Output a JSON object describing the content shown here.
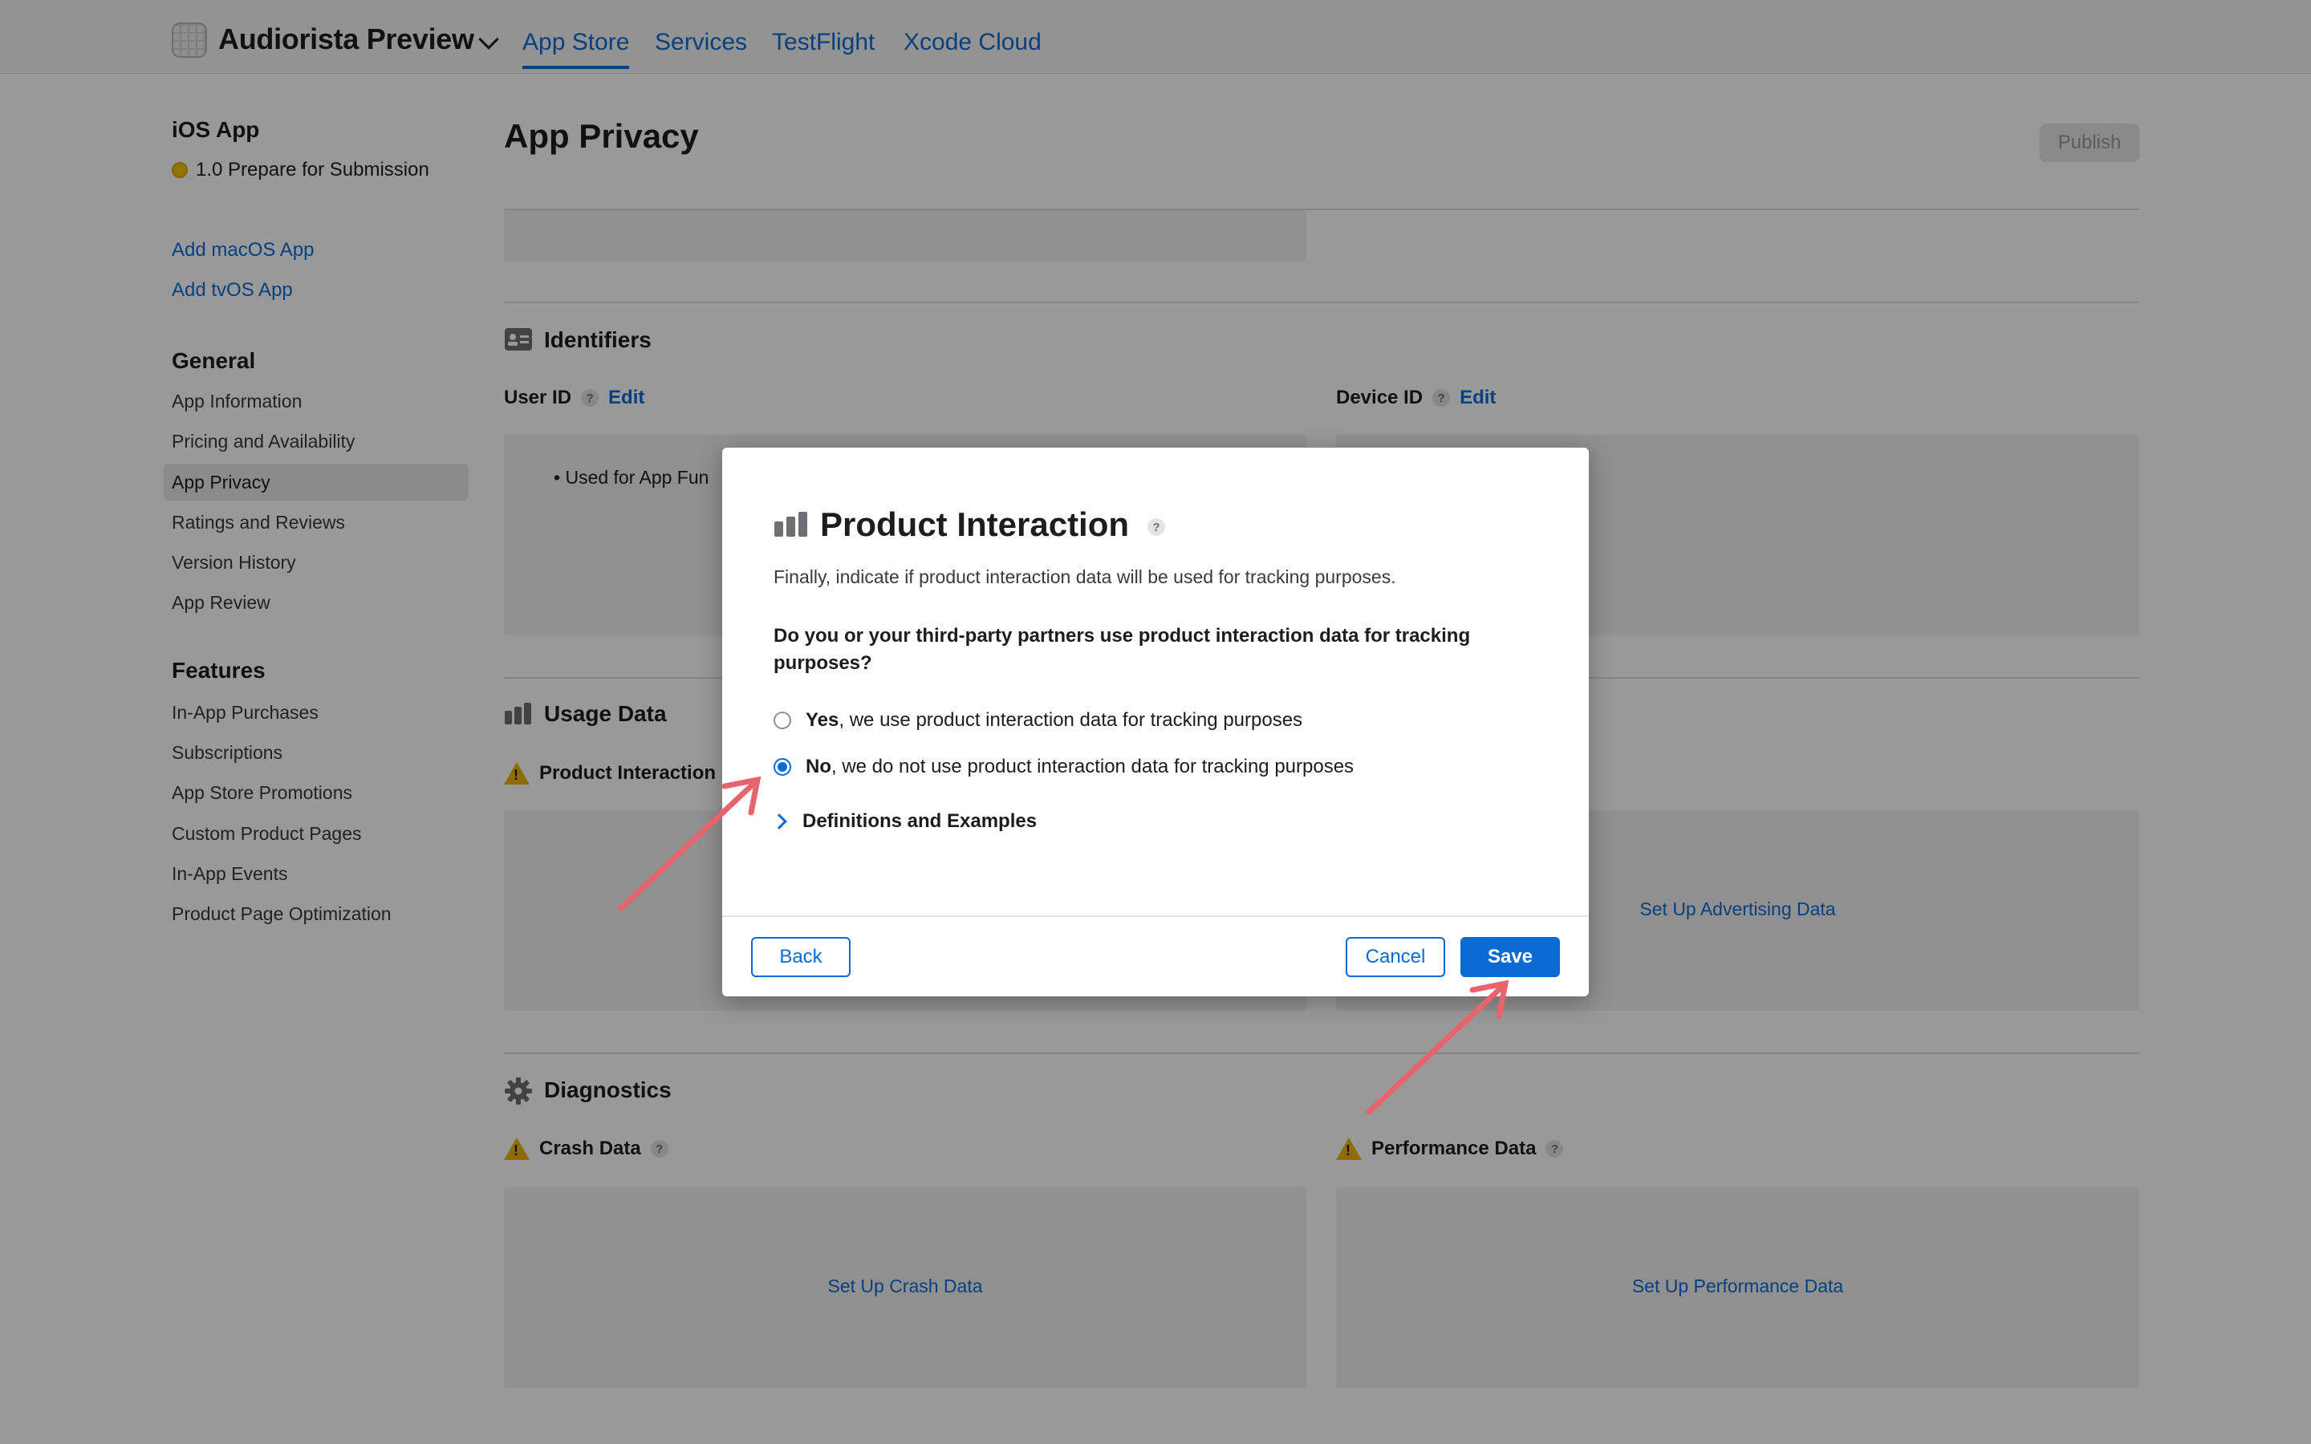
{
  "header": {
    "app_name": "Audiorista Preview",
    "tabs": [
      {
        "label": "App Store",
        "active": true
      },
      {
        "label": "Services"
      },
      {
        "label": "TestFlight"
      },
      {
        "label": "Xcode Cloud"
      }
    ]
  },
  "sidebar": {
    "platform_title": "iOS App",
    "version_status": "1.0 Prepare for Submission",
    "add_links": [
      "Add macOS App",
      "Add tvOS App"
    ],
    "general_title": "General",
    "general_items": [
      "App Information",
      "Pricing and Availability",
      "App Privacy",
      "Ratings and Reviews",
      "Version History",
      "App Review"
    ],
    "features_title": "Features",
    "features_items": [
      "In-App Purchases",
      "Subscriptions",
      "App Store Promotions",
      "Custom Product Pages",
      "In-App Events",
      "Product Page Optimization"
    ],
    "selected": "App Privacy"
  },
  "main": {
    "page_title": "App Privacy",
    "publish_label": "Publish",
    "identifiers": {
      "title": "Identifiers",
      "user_id_label": "User ID",
      "device_id_label": "Device ID",
      "edit_label": "Edit",
      "user_id_usage": "Used for App Fun"
    },
    "usage": {
      "title": "Usage Data",
      "product_interaction_label": "Product Interaction",
      "advertising_link": "Set Up Advertising Data"
    },
    "diagnostics": {
      "title": "Diagnostics",
      "crash_label": "Crash Data",
      "performance_label": "Performance Data",
      "crash_link": "Set Up Crash Data",
      "performance_link": "Set Up Performance Data"
    },
    "help_glyph": "?"
  },
  "modal": {
    "title": "Product Interaction",
    "subtitle": "Finally, indicate if product interaction data will be used for tracking purposes.",
    "question": "Do you or your third-party partners use product interaction data for tracking purposes?",
    "option_yes_bold": "Yes",
    "option_yes_rest": ", we use product interaction data for tracking purposes",
    "option_no_bold": "No",
    "option_no_rest": ", we do not use product interaction data for tracking purposes",
    "selected_option": "No",
    "disclosure_label": "Definitions and Examples",
    "back_label": "Back",
    "cancel_label": "Cancel",
    "save_label": "Save"
  },
  "colors": {
    "accent": "#0a6bd4",
    "warning": "#f0b400",
    "status_dot": "#f4c20d",
    "annotation_arrow": "#e8646c"
  }
}
